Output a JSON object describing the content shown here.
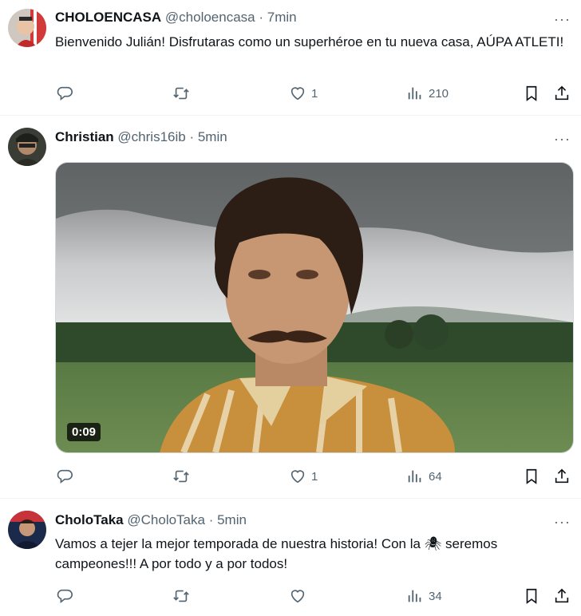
{
  "tweets": [
    {
      "name": "CHOLOENCASA",
      "handle": "@choloencasa",
      "time": "7min",
      "text": "Bienvenido Julián! Disfrutaras como un superhéroe en tu nueva casa, AÚPA ATLETI!",
      "likes": "1",
      "views": "210"
    },
    {
      "name": "Christian",
      "handle": "@chris16ib",
      "time": "5min",
      "video_duration": "0:09",
      "likes": "1",
      "views": "64"
    },
    {
      "name": "CholoTaka",
      "handle": "@CholoTaka",
      "time": "5min",
      "text_before": "Vamos a tejer la mejor temporada de nuestra historia! Con la",
      "emoji": "🕷",
      "text_after": "seremos campeones!!! A por todo y a por todos!",
      "likes": "",
      "views": "34"
    }
  ],
  "separator": " · ",
  "more_glyph": "···",
  "colors": {
    "text": "#0f1419",
    "muted": "#536471",
    "border": "#eff3f4"
  },
  "icons": [
    "reply-icon",
    "retweet-icon",
    "like-icon",
    "views-icon",
    "bookmark-icon",
    "share-icon"
  ]
}
